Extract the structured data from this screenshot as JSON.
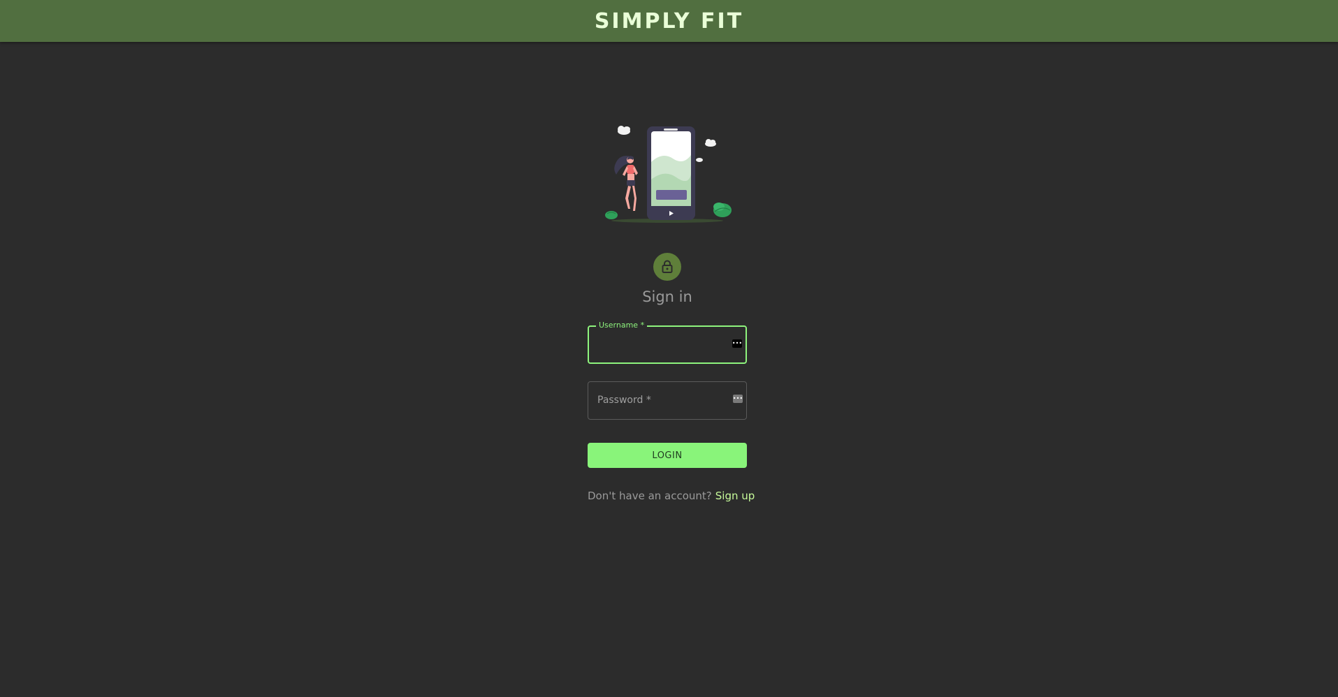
{
  "header": {
    "brand": "SIMPLY FIT"
  },
  "icons": {
    "lock": "lock-icon",
    "illustration": "runner-phone-illustration",
    "password_manager": "password-manager-icon"
  },
  "form": {
    "title": "Sign in",
    "username": {
      "label": "Username *",
      "value": ""
    },
    "password": {
      "label": "Password *",
      "value": ""
    },
    "login_label": "LOGIN",
    "signup_prompt": "Don't have an account?",
    "signup_link": "Sign up"
  },
  "colors": {
    "header_bg": "#516f40",
    "page_bg": "#2c2c2c",
    "accent": "#8ef47d",
    "avatar_bg": "#5f7f3a",
    "link": "#c7fb9a"
  }
}
